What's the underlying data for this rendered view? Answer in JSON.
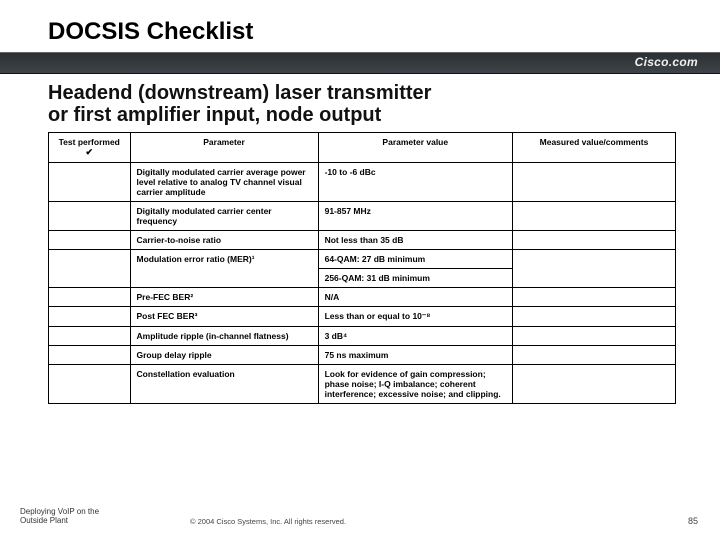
{
  "title": "DOCSIS Checklist",
  "brand": "Cisco.com",
  "subtitle_line1": "Headend (downstream) laser transmitter",
  "subtitle_line2": " or first amplifier input, node output",
  "columns": {
    "c1a": "Test performed",
    "c1b": "✔",
    "c2": "Parameter",
    "c3": "Parameter value",
    "c4": "Measured value/comments"
  },
  "rows": [
    {
      "param": "Digitally modulated carrier average power level relative to analog TV channel visual carrier amplitude",
      "value": "-10 to -6 dBc"
    },
    {
      "param": "Digitally modulated carrier center frequency",
      "value": "91-857 MHz"
    },
    {
      "param": "Carrier-to-noise ratio",
      "value": "Not less than 35 dB"
    },
    {
      "param": "Modulation error ratio (MER)¹",
      "value": "64-QAM: 27 dB minimum"
    },
    {
      "param": "",
      "value": "256-QAM: 31 dB minimum"
    },
    {
      "param": "Pre-FEC BER²",
      "value": "N/A"
    },
    {
      "param": "Post FEC BER³",
      "value": "Less than or equal to 10⁻⁸"
    },
    {
      "param": "Amplitude ripple (in-channel flatness)",
      "value": "3 dB⁴"
    },
    {
      "param": "Group delay ripple",
      "value": "75 ns maximum"
    },
    {
      "param": "Constellation evaluation",
      "value": "Look for evidence of gain compression; phase noise; I-Q imbalance; coherent interference; excessive noise; and clipping."
    }
  ],
  "footer_line1": "Deploying VoIP on the",
  "footer_line2": "Outside Plant",
  "copyright": "© 2004 Cisco Systems, Inc. All rights reserved.",
  "page": "85"
}
